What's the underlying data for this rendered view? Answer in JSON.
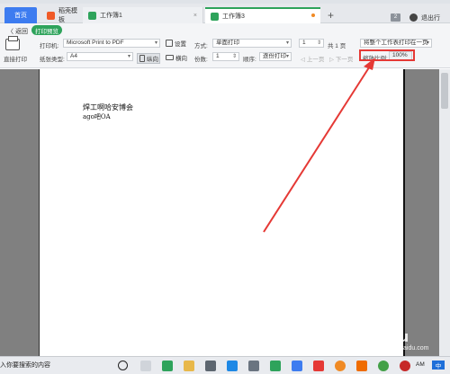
{
  "tabs": {
    "home": "首页",
    "template": "稻壳模板",
    "sheet1": "工作簿1",
    "sheet3": "工作簿3",
    "close": "×",
    "add": "+",
    "count": "2",
    "exit": "退出行"
  },
  "toolbar": {
    "back": "〈 返回",
    "preview": "打印预览",
    "direct_print": "直接打印",
    "printer_label": "打印机:",
    "printer_value": "Microsoft Print to PDF",
    "settings": "设置",
    "paper_label": "纸张类型:",
    "paper_value": "A4",
    "landscape": "纵向",
    "mirror": "横向",
    "mode_label": "方式:",
    "mode_value": "单面打印",
    "copies_label": "份数:",
    "copies_value": "1",
    "order_label": "顺序:",
    "order_value": "逐份打印",
    "page_value": "1",
    "total_pages": "共 1 页",
    "prev_page": "上一页",
    "next_page": "下一页",
    "fit_value": "将整个工作表打印在一页",
    "zoom_label": "缩放比例:",
    "zoom_value": "100%"
  },
  "page": {
    "line1": "焊工啊哈安博会",
    "line2": "ago吧OA"
  },
  "taskbar": {
    "search": "入你要搜索的内容",
    "time": "AM",
    "lang": "中"
  },
  "watermark": {
    "brand": "Baidu",
    "url": "jingyan.baidu.com"
  },
  "colors": {
    "accent": "#2ea35b",
    "home_tab": "#3d7cf0",
    "highlight": "#e53935"
  }
}
